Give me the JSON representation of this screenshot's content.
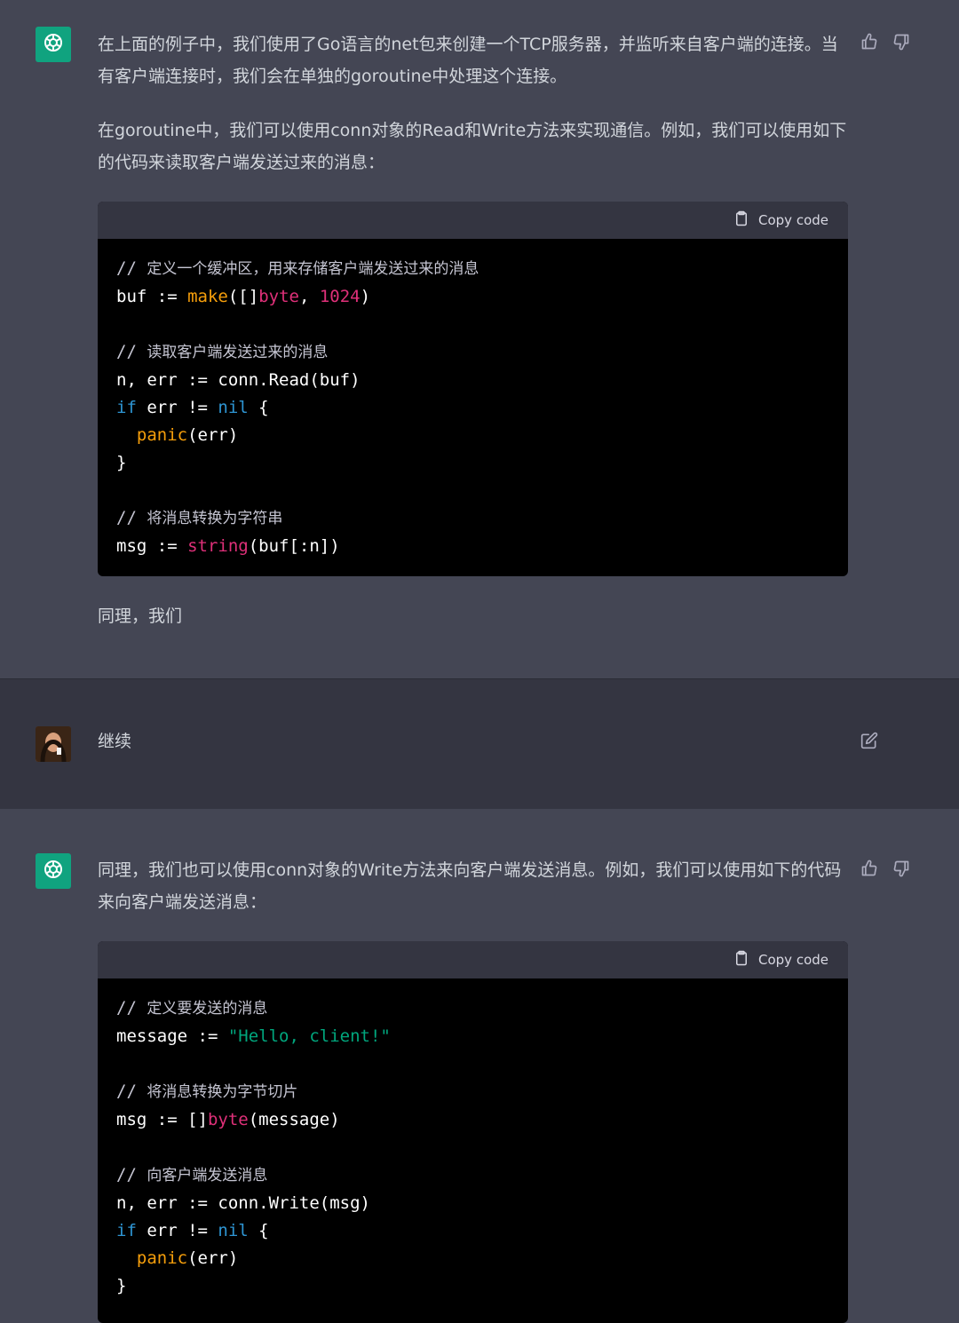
{
  "messages": {
    "first": {
      "para1": "在上面的例子中，我们使用了Go语言的net包来创建一个TCP服务器，并监听来自客户端的连接。当有客户端连接时，我们会在单独的goroutine中处理这个连接。",
      "para2": "在goroutine中，我们可以使用conn对象的Read和Write方法来实现通信。例如，我们可以使用如下的代码来读取客户端发送过来的消息：",
      "copy_label": "Copy code",
      "code": {
        "c1": "定义一个缓冲区，用来存储客户端发送过来的消息",
        "l1_var": "buf",
        "l1_op": " := ",
        "l1_fn": "make",
        "l1_open": "([]",
        "l1_type": "byte",
        "l1_sep": ", ",
        "l1_num": "1024",
        "l1_close": ")",
        "c2": "读取客户端发送过来的消息",
        "l2": "n, err := conn.Read(buf)",
        "l3_kw": "if",
        "l3_mid": " err != ",
        "l3_nil": "nil",
        "l3_end": " {",
        "l4_fn": "panic",
        "l4_rest": "(err)",
        "l5": "}",
        "c3": "将消息转换为字符串",
        "l6_var": "msg := ",
        "l6_type": "string",
        "l6_rest": "(buf[:n])"
      },
      "trailing": "同理，我们"
    },
    "user": {
      "text": "继续"
    },
    "second": {
      "para1": "同理，我们也可以使用conn对象的Write方法来向客户端发送消息。例如，我们可以使用如下的代码来向客户端发送消息：",
      "copy_label": "Copy code",
      "code": {
        "c1": "定义要发送的消息",
        "l1_var": "message := ",
        "l1_str": "\"Hello, client!\"",
        "c2": "将消息转换为字节切片",
        "l2_var": "msg := []",
        "l2_type": "byte",
        "l2_rest": "(message)",
        "c3": "向客户端发送消息",
        "l3": "n, err := conn.Write(msg)",
        "l4_kw": "if",
        "l4_mid": " err != ",
        "l4_nil": "nil",
        "l4_end": " {",
        "l5_fn": "panic",
        "l5_rest": "(err)",
        "l6": "}"
      }
    }
  },
  "icons": {
    "assistant_avatar": "openai-logo-icon",
    "like": "thumbs-up-icon",
    "dislike": "thumbs-down-icon",
    "copy": "clipboard-icon",
    "edit": "edit-icon"
  },
  "colors": {
    "assistant_bg": "#444654",
    "user_bg": "#343541",
    "avatar_green": "#10a37f",
    "code_bg": "#000000",
    "code_header_bg": "#343541",
    "keyword": "#2e95d3",
    "function": "#f59e0b",
    "type_number": "#df3079",
    "string": "#00a67d"
  }
}
